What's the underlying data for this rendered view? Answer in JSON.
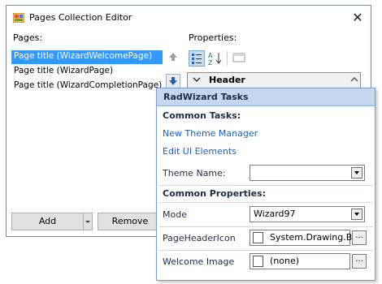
{
  "window": {
    "title": "Pages Collection Editor",
    "close_glyph": "✕"
  },
  "pages_panel": {
    "label": "Pages:",
    "items": [
      {
        "label": "Page title (WizardWelcomePage)",
        "selected": true
      },
      {
        "label": "Page title (WizardPage)",
        "selected": false
      },
      {
        "label": "Page title (WizardCompletionPage)",
        "selected": false
      }
    ],
    "add_label": "Add",
    "remove_label": "Remove"
  },
  "properties_panel": {
    "label": "Properties:",
    "grid_header": "Header",
    "toolbar_icons": [
      "categorized-icon",
      "alphabetical-icon",
      "property-pages-icon"
    ]
  },
  "smart_tag": {
    "title": "RadWizard Tasks",
    "common_tasks_label": "Common Tasks:",
    "links": [
      "New Theme Manager",
      "Edit UI Elements"
    ],
    "theme_name_label": "Theme Name:",
    "theme_name_value": "",
    "common_props_label": "Common Properties:",
    "mode_label": "Mode",
    "mode_value": "Wizard97",
    "page_header_icon_label": "PageHeaderIcon",
    "page_header_icon_value": "System.Drawing.Bi",
    "welcome_image_label": "Welcome Image",
    "welcome_image_value": "(none)",
    "ellipsis": "..."
  },
  "colors": {
    "selection": "#3399ff",
    "link": "#1c5fb7",
    "panel_header": "#c4d7ee"
  }
}
